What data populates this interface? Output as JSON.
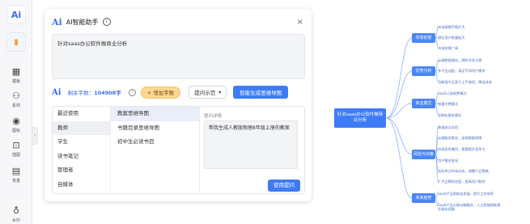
{
  "rail": {
    "logo": "Ai",
    "items": [
      {
        "icon": "▦",
        "label": "模板"
      },
      {
        "icon": "⚇",
        "label": "素材"
      },
      {
        "icon": "◉",
        "label": "图标"
      },
      {
        "icon": "⊡",
        "label": "插图"
      },
      {
        "icon": "▤",
        "label": "背景"
      },
      {
        "icon": "♁",
        "label": "水印"
      }
    ],
    "collapse_icon": "›"
  },
  "dialog": {
    "logo": "Ai",
    "title": "AI智能助手",
    "info_icon": "i",
    "close_icon": "×",
    "prompt_text": "针对saas办公软件做商业分析",
    "toolbar": {
      "logo": "Ai",
      "remaining_label": "剩余字数：",
      "remaining_value": "104908字",
      "add_button": "+ 增加字数",
      "example_button": "提问示范",
      "generate_button": "智能生成思维导图"
    },
    "categories": [
      "最近使用",
      "教师",
      "学生",
      "读书笔记",
      "管理者",
      "自媒体"
    ],
    "subcategories": [
      "教案思维导图",
      "书籍目录思维导图",
      "初中生必读书目"
    ],
    "detail_label": "提问详情",
    "detail_text": "帮我生成人教版物理8年级上册的教案",
    "use_button": "使用提问"
  },
  "mindmap": {
    "root": "针对saas办公软件做商业分析",
    "branches": [
      {
        "label": "市场前景",
        "leaves": [
          "市场规模不断扩大",
          "潜在用户数量庞大",
          "市场前景广阔"
        ]
      },
      {
        "label": "优势分析",
        "leaves": [
          "云端数据储存，随时共享方便",
          "多平台适配，满足不同用户需求",
          "功能强大且易于上手使用，降低成本"
        ]
      },
      {
        "label": "商业模式",
        "leaves": [
          "SaaS订阅收费模式",
          "按量付费模式",
          "定制化服务模式"
        ]
      },
      {
        "label": "风险与对策",
        "leaves": [
          "数据安全风险",
          "云端服务稳定，加强数据保障",
          "市场竞争激烈，需要提升竞争力",
          "用户需求变化",
          "及时关注市场动态，调整产品策略",
          "扩大品牌知名度，提高用户黏性"
        ]
      },
      {
        "label": "未来趋势",
        "leaves": [
          "SaaS产品智能化发展，提升工作效率",
          "SaaS产品与移动端融合，人工智能赋能提升服务质量"
        ]
      }
    ]
  }
}
